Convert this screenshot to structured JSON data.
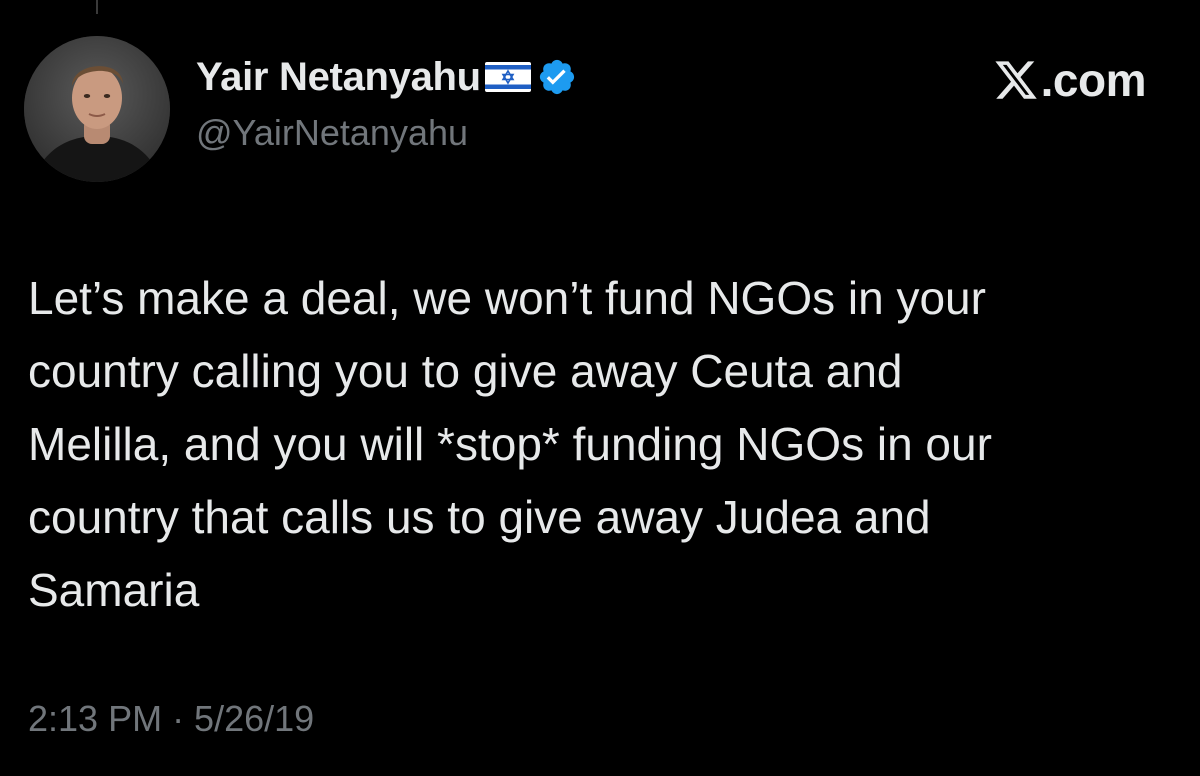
{
  "brand": {
    "text": ".com",
    "icon": "x-logo-icon"
  },
  "author": {
    "display_name": "Yair Netanyahu",
    "handle": "@YairNetanyahu",
    "flag_icon": "israel-flag-icon",
    "verified_icon": "verified-badge-icon",
    "verified_color": "#1d9bf0"
  },
  "tweet": {
    "lines": [
      "Let’s make a deal, we won’t fund NGOs in your",
      "country calling you to give away Ceuta and",
      "Melilla, and you will *stop* funding NGOs in our",
      "country that calls us to give away Judea and",
      "Samaria"
    ],
    "timestamp": "2:13 PM · 5/26/19"
  },
  "colors": {
    "background": "#000000",
    "primary_text": "#e7e9ea",
    "secondary_text": "#71767b"
  }
}
